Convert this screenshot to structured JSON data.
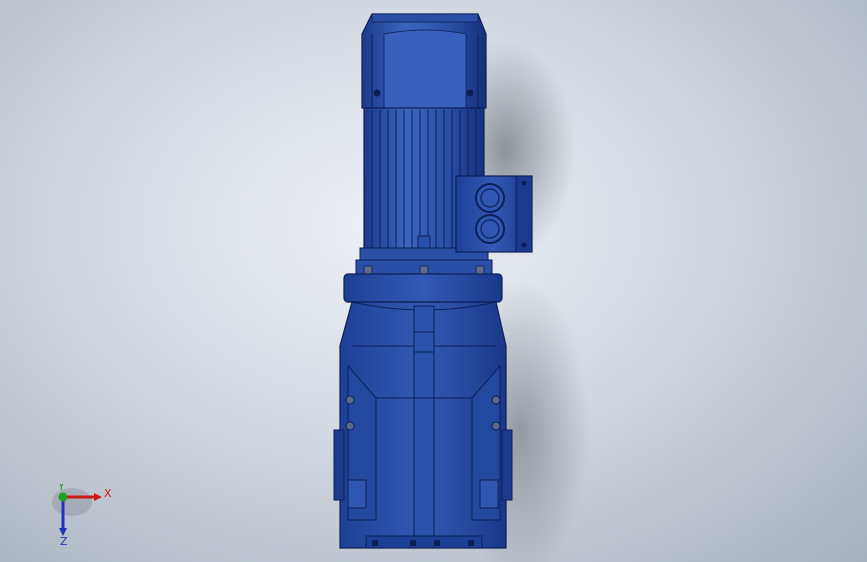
{
  "viewport": {
    "background_top": "#eef1f6",
    "background_bottom": "#a7b0bd",
    "model": {
      "name": "gear-motor-assembly",
      "body_color": "#2a4fa8",
      "dark_color": "#0d1e56",
      "highlight_color": "#4f77cc"
    },
    "triad": {
      "x_label": "X",
      "y_label": "Y",
      "z_label": "Z",
      "x_color": "#d01818",
      "y_color": "#20a020",
      "z_color": "#2030c0"
    }
  }
}
